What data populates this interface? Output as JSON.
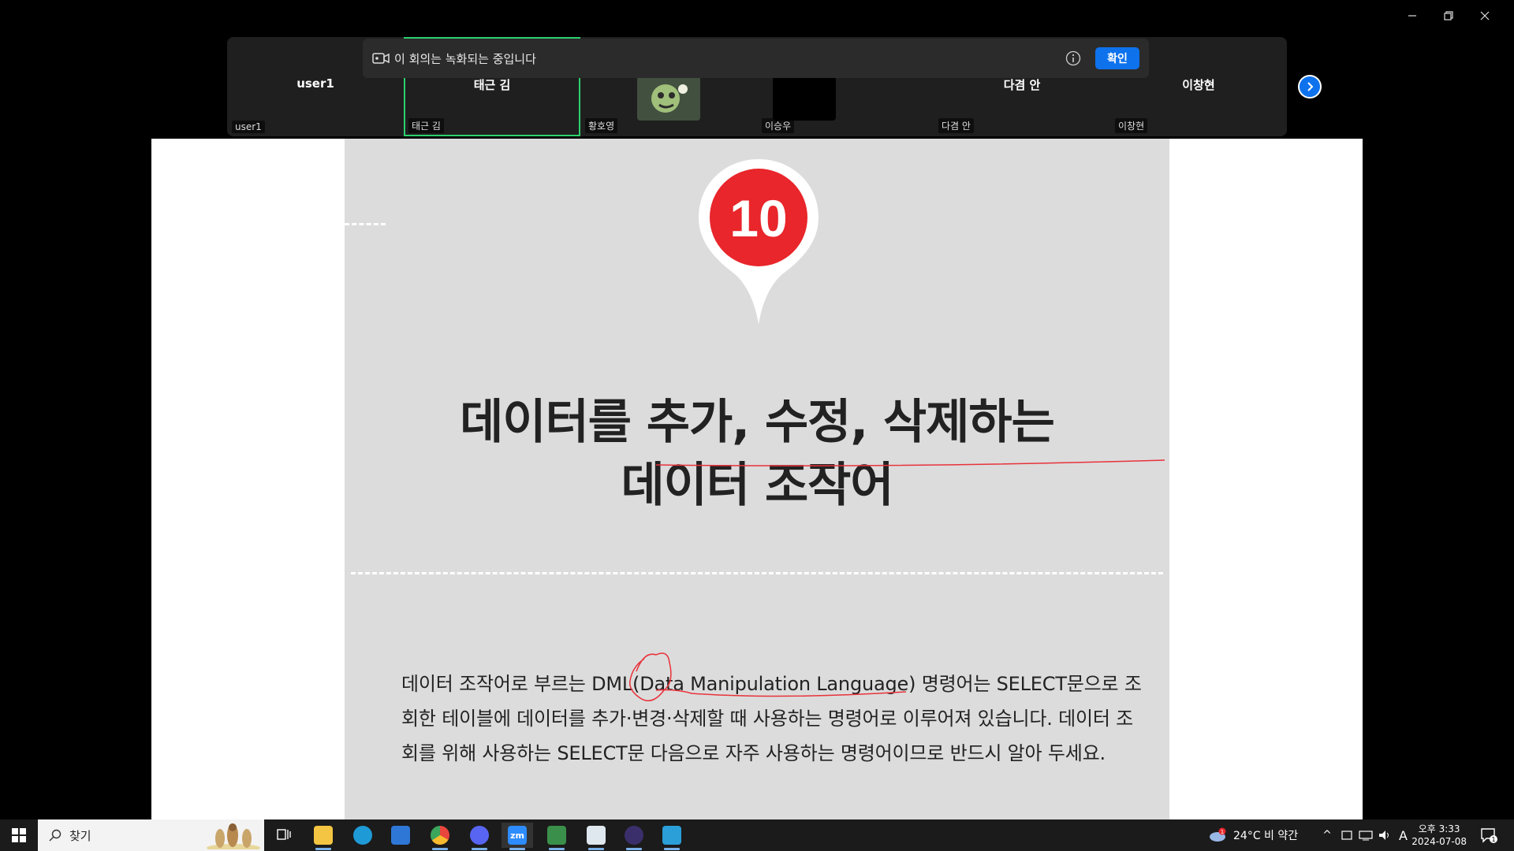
{
  "participants": [
    {
      "center": "user1",
      "label": "user1",
      "active": false
    },
    {
      "center": "태근 김",
      "label": "태근 김",
      "active": true
    },
    {
      "center": "",
      "label": "황호영",
      "active": false
    },
    {
      "center": "",
      "label": "이승우",
      "active": false
    },
    {
      "center": "다겸 안",
      "label": "다겸 안",
      "active": false
    },
    {
      "center": "이창현",
      "label": "이창현",
      "active": false
    }
  ],
  "banner": {
    "message": "이 회의는 녹화되는 중입니다",
    "confirm_label": "확인"
  },
  "slide": {
    "badge_number": "10",
    "title_line1": "데이터를 추가, 수정, 삭제하는",
    "title_line2": "데이터 조작어",
    "paragraph": "데이터 조작어로 부르는 DML(Data Manipulation Language) 명령어는 SELECT문으로 조회한 테이블에 데이터를 추가·변경·삭제할 때 사용하는 명령어로 이루어져 있습니다. 데이터 조회를 위해 사용하는 SELECT문 다음으로 자주 사용하는 명령어이므로 반드시 알아 두세요."
  },
  "taskbar": {
    "search_text": "찾기",
    "weather": "24°C 비 약간",
    "weather_badge": "1",
    "ime": "A",
    "time": "오후 3:33",
    "date": "2024-07-08",
    "notification_count": "1"
  },
  "colors": {
    "accent": "#0e72ed",
    "active_border": "#2ed06e",
    "badge_red": "#e8262b",
    "annotation": "#e8323a"
  }
}
